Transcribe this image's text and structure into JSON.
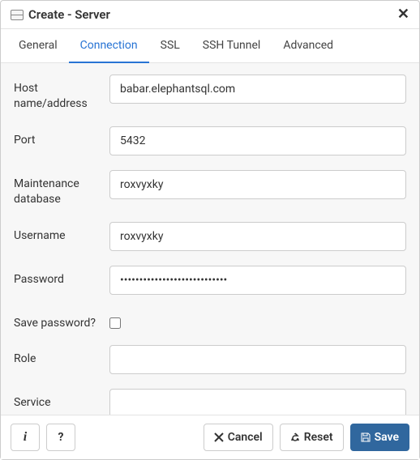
{
  "header": {
    "title": "Create - Server"
  },
  "tabs": {
    "general": "General",
    "connection": "Connection",
    "ssl": "SSL",
    "ssh_tunnel": "SSH Tunnel",
    "advanced": "Advanced"
  },
  "form": {
    "host_label": "Host name/address",
    "host_value": "babar.elephantsql.com",
    "port_label": "Port",
    "port_value": "5432",
    "maintdb_label": "Maintenance database",
    "maintdb_value": "roxvyxky",
    "username_label": "Username",
    "username_value": "roxvyxky",
    "password_label": "Password",
    "password_value": "xxxxxxxxxxxxxxxxxxxxxxxxxxxx",
    "savepw_label": "Save password?",
    "role_label": "Role",
    "role_value": "",
    "service_label": "Service",
    "service_value": ""
  },
  "footer": {
    "info": "i",
    "help": "?",
    "cancel": "Cancel",
    "reset": "Reset",
    "save": "Save"
  }
}
